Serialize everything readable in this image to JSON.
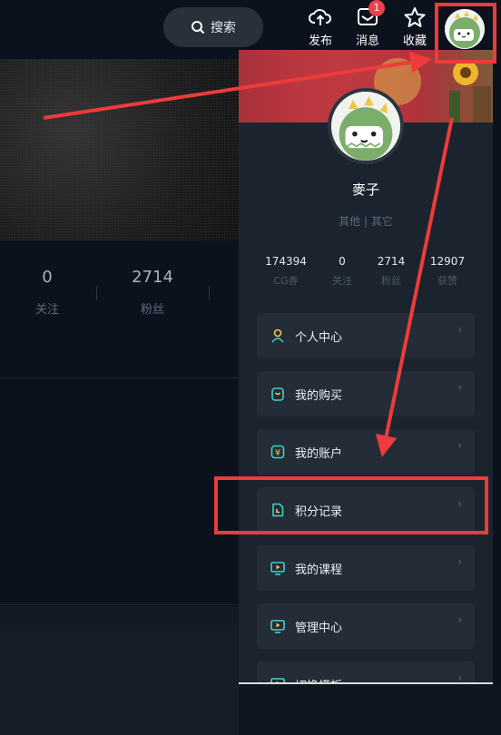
{
  "topbar": {
    "search_label": "搜索",
    "publish_label": "发布",
    "messages_label": "消息",
    "messages_badge": "1",
    "favorites_label": "收藏"
  },
  "profile_stats_left": [
    {
      "value": "0",
      "label": "关注"
    },
    {
      "value": "2714",
      "label": "粉丝"
    }
  ],
  "panel": {
    "username": "麥子",
    "tags": "其他 | 其它",
    "stats": [
      {
        "value": "174394",
        "label": "CG券"
      },
      {
        "value": "0",
        "label": "关注"
      },
      {
        "value": "2714",
        "label": "粉丝"
      },
      {
        "value": "12907",
        "label": "获赞"
      }
    ],
    "menu": [
      {
        "label": "个人中心",
        "icon": "person-icon"
      },
      {
        "label": "我的购买",
        "icon": "shopping-bag-icon"
      },
      {
        "label": "我的账户",
        "icon": "yen-icon"
      },
      {
        "label": "积分记录",
        "icon": "points-record-icon"
      },
      {
        "label": "我的课程",
        "icon": "monitor-play-icon"
      },
      {
        "label": "管理中心",
        "icon": "monitor-play-icon"
      },
      {
        "label": "切换模板",
        "icon": "monitor-play-icon"
      }
    ]
  },
  "colors": {
    "background": "#0b121d",
    "panel": "#1b242e",
    "menu_item": "#232c37",
    "accent_teal": "#3fd3c5",
    "annotation_red": "#ee3b3b"
  }
}
